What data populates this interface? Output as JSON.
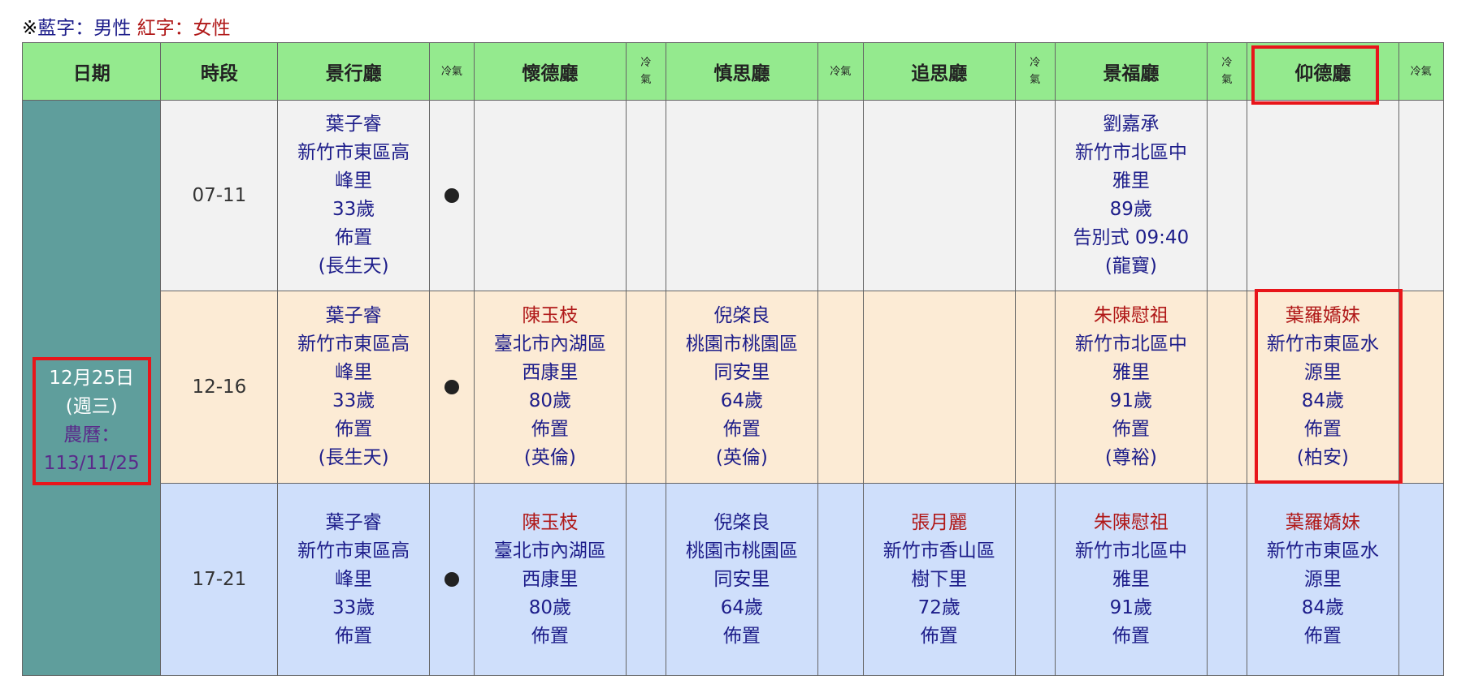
{
  "legend": {
    "prefix": "※",
    "male_label": "藍字：男性",
    "female_label": "紅字：女性"
  },
  "headers": {
    "date": "日期",
    "slot": "時段",
    "halls": [
      "景行廳",
      "懷德廳",
      "慎思廳",
      "追思廳",
      "景福廳",
      "仰德廳"
    ],
    "ac_wide": "冷氣",
    "ac_stack_top": "冷",
    "ac_stack_bottom": "氣"
  },
  "date": {
    "day": "12月25日",
    "weekday": "(週三)",
    "lunar_label": "農曆：",
    "lunar_date": "113/11/25"
  },
  "rows": [
    {
      "slot": "07-11",
      "cells": [
        {
          "name": "葉子睿",
          "address1": "新竹市東區高",
          "address2": "峰里",
          "age": "33歲",
          "event": "佈置",
          "firm": "(長生天)",
          "ac": "●"
        },
        {},
        {},
        {},
        {
          "name": "劉嘉承",
          "address1": "新竹市北區中",
          "address2": "雅里",
          "age": "89歲",
          "event": "告別式 09:40",
          "firm": "(龍寶)"
        },
        {}
      ]
    },
    {
      "slot": "12-16",
      "cells": [
        {
          "name": "葉子睿",
          "address1": "新竹市東區高",
          "address2": "峰里",
          "age": "33歲",
          "event": "佈置",
          "firm": "(長生天)",
          "ac": "●"
        },
        {
          "name": "陳玉枝",
          "address1": "臺北市內湖區",
          "address2": "西康里",
          "age": "80歲",
          "event": "佈置",
          "firm": "(英倫)"
        },
        {
          "name": "倪棨良",
          "address1": "桃園市桃園區",
          "address2": "同安里",
          "age": "64歲",
          "event": "佈置",
          "firm": "(英倫)"
        },
        {},
        {
          "name": "朱陳慰祖",
          "address1": "新竹市北區中",
          "address2": "雅里",
          "age": "91歲",
          "event": "佈置",
          "firm": "(尊裕)"
        },
        {
          "name": "葉羅嬌妹",
          "address1": "新竹市東區水",
          "address2": "源里",
          "age": "84歲",
          "event": "佈置",
          "firm": "(柏安)"
        }
      ]
    },
    {
      "slot": "17-21",
      "cells": [
        {
          "name": "葉子睿",
          "address1": "新竹市東區高",
          "address2": "峰里",
          "age": "33歲",
          "event": "佈置",
          "firm": "",
          "ac": "●"
        },
        {
          "name": "陳玉枝",
          "address1": "臺北市內湖區",
          "address2": "西康里",
          "age": "80歲",
          "event": "佈置",
          "firm": ""
        },
        {
          "name": "倪棨良",
          "address1": "桃園市桃園區",
          "address2": "同安里",
          "age": "64歲",
          "event": "佈置",
          "firm": ""
        },
        {
          "name": "張月麗",
          "address1": "新竹市香山區",
          "address2": "樹下里",
          "age": "72歲",
          "event": "佈置",
          "firm": ""
        },
        {
          "name": "朱陳慰祖",
          "address1": "新竹市北區中",
          "address2": "雅里",
          "age": "91歲",
          "event": "佈置",
          "firm": ""
        },
        {
          "name": "葉羅嬌妹",
          "address1": "新竹市東區水",
          "address2": "源里",
          "age": "84歲",
          "event": "佈置",
          "firm": ""
        }
      ]
    }
  ],
  "colors": {
    "header_bg": "#94ea8e",
    "date_bg": "#5f9e9c",
    "male_text": "#1d1d8a",
    "female_text": "#b01818",
    "row1_bg": "#f2f2f2",
    "row2_bg": "#fcebd5",
    "row3_bg": "#cfdffb",
    "highlight": "#e8151a"
  }
}
